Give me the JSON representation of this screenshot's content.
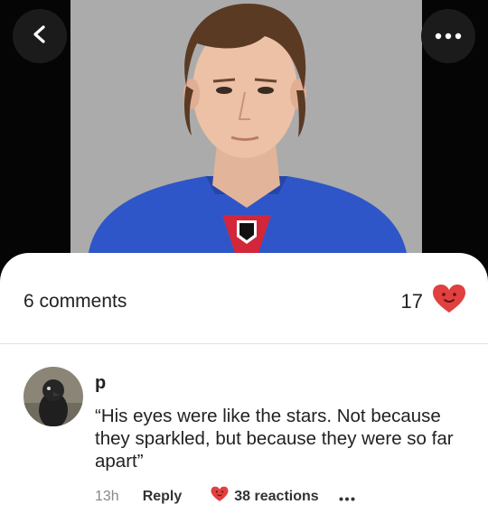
{
  "header": {
    "back_icon": "chevron-left-icon",
    "more_icon": "ellipsis-icon"
  },
  "post": {
    "comments_label": "6 comments",
    "likes_count": "17",
    "like_icon": "smiling-heart-icon"
  },
  "comment": {
    "author": "p",
    "text": "“His eyes were like the stars. Not because they sparkled, but because they were so far apart”",
    "time": "13h",
    "reply_label": "Reply",
    "reactions_label": "38 reactions",
    "more_icon": "ellipsis-icon"
  },
  "colors": {
    "heart": "#e0403f",
    "jersey": "#2f56c8"
  }
}
